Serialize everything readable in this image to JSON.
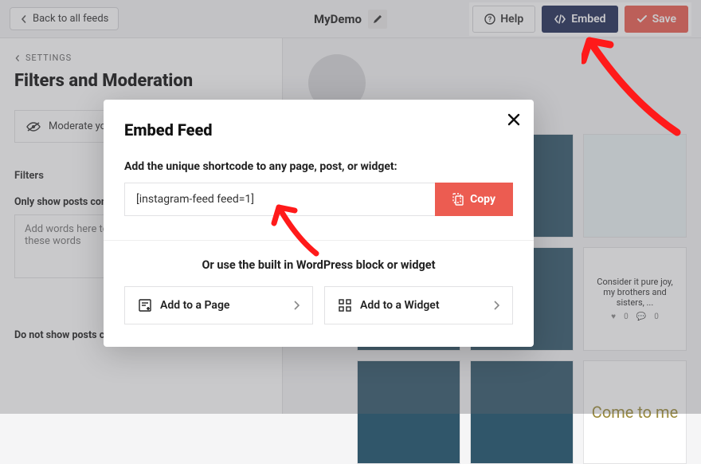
{
  "topbar": {
    "back_label": "Back to all feeds",
    "feed_name": "MyDemo",
    "help_label": "Help",
    "embed_label": "Embed",
    "save_label": "Save"
  },
  "sidebar": {
    "settings_label": "SETTINGS",
    "page_title": "Filters and Moderation",
    "moderate_label": "Moderate your feed",
    "filters_label": "Filters",
    "only_show_label": "Only show posts containing",
    "only_show_placeholder": "Add words here to only show posts containing these words",
    "do_not_show_label": "Do not show posts containing"
  },
  "preview": {
    "tile_caption": "Consider it pure joy, my brothers and sisters, ...",
    "tile_like_count": "0",
    "tile_comment_count": "0",
    "tile_gold_text": "Come to me"
  },
  "modal": {
    "title": "Embed Feed",
    "subtitle": "Add the unique shortcode to any page, post, or widget:",
    "shortcode": "[instagram-feed feed=1]",
    "copy_label": "Copy",
    "alt_subtitle": "Or use the built in WordPress block or widget",
    "add_page_label": "Add to a Page",
    "add_widget_label": "Add to a Widget"
  }
}
